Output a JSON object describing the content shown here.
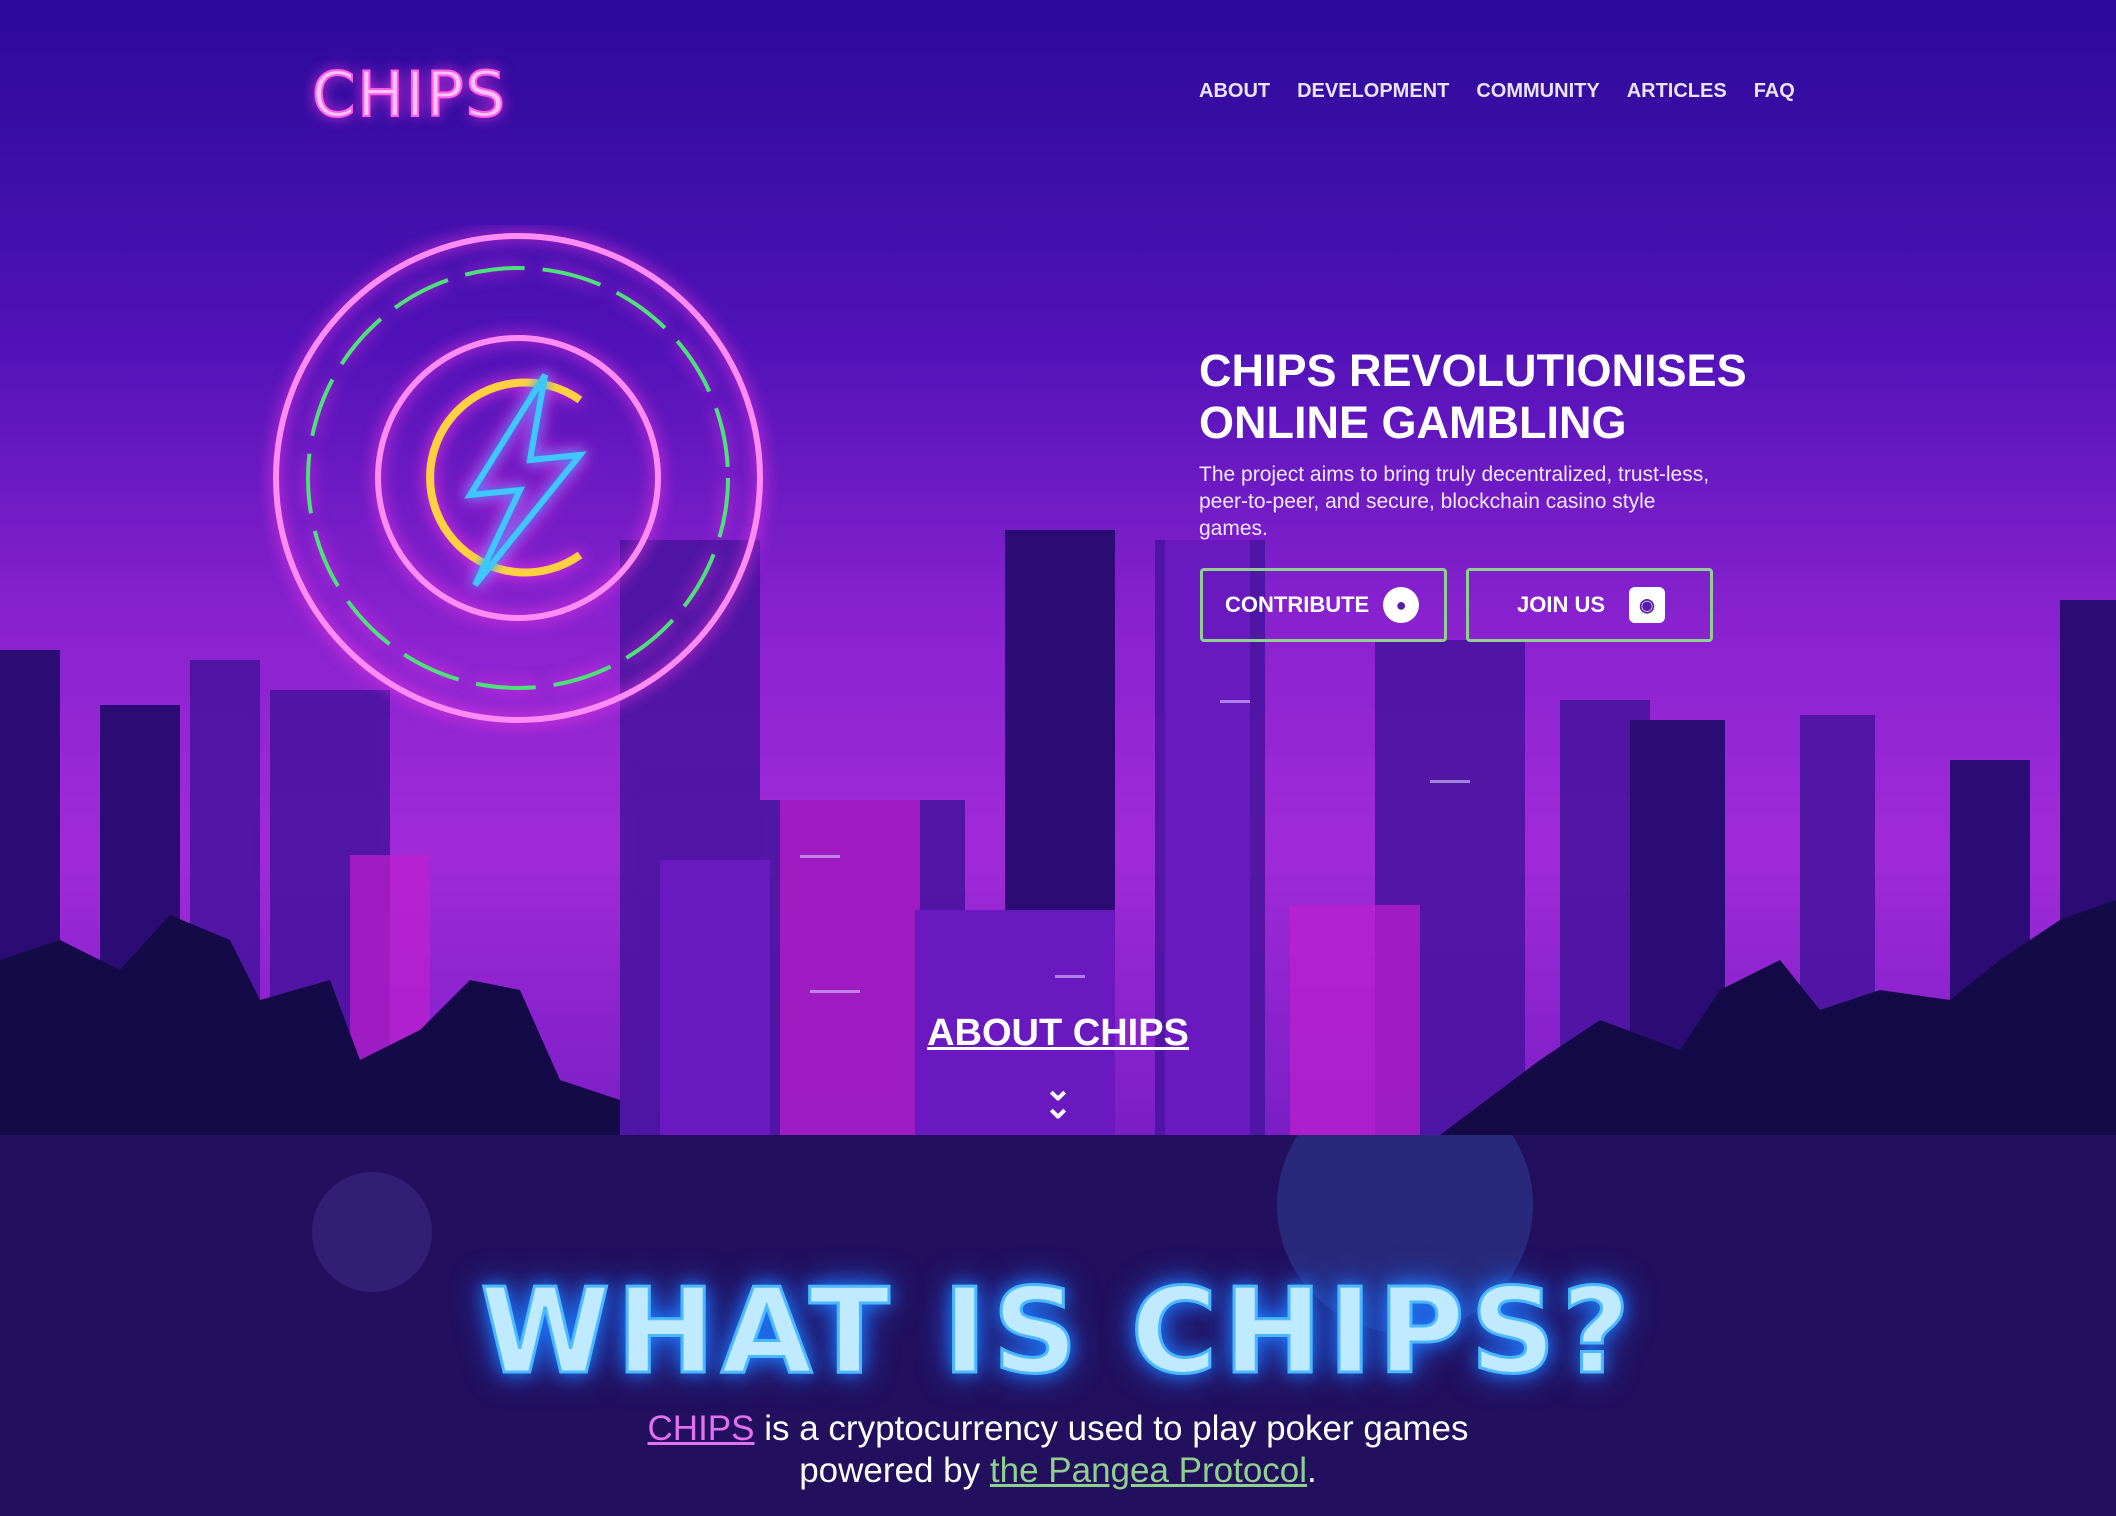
{
  "header": {
    "logo": "CHIPS",
    "nav": [
      "ABOUT",
      "DEVELOPMENT",
      "COMMUNITY",
      "ARTICLES",
      "FAQ"
    ]
  },
  "hero": {
    "title_line1": "CHIPS REVOLUTIONISES",
    "title_line2": "ONLINE GAMBLING",
    "description": "The project aims to bring truly decentralized, trust-less, peer-to-peer, and secure, blockchain casino style games.",
    "contribute_label": "CONTRIBUTE",
    "contribute_icon": "github-icon",
    "join_label": "JOIN US",
    "join_icon": "discord-icon",
    "button_border_color": "#8fd08f",
    "about_link": "ABOUT CHIPS",
    "scroll_icon": "double-chevron-down-icon"
  },
  "what": {
    "heading": "WHAT IS CHIPS?",
    "link1": "CHIPS",
    "text1": " is a cryptocurrency used to play poker games",
    "text2": "powered by ",
    "link2": "the Pangea Protocol",
    "text3": "."
  },
  "colors": {
    "neon_pink": "#ff7cf2",
    "neon_blue": "#7fd8ff",
    "section_bg": "#22105e"
  }
}
